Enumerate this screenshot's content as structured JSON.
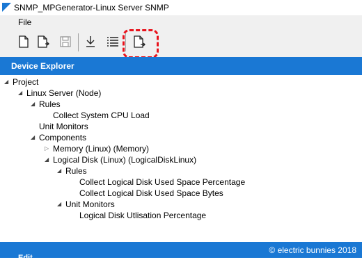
{
  "window": {
    "title": "SNMP_MPGenerator-Linux Server SNMP"
  },
  "menu": {
    "file_label": "File"
  },
  "toolbar": {
    "buttons": [
      "new-document-icon",
      "new-document-arrow-icon",
      "save-icon",
      "download-icon",
      "list-icon",
      "export-document-icon"
    ]
  },
  "explorer": {
    "title": "Device Explorer",
    "tree": {
      "project": "Project",
      "linux_server": "Linux Server (Node)",
      "rules": "Rules",
      "collect_cpu": "Collect System CPU Load",
      "unit_monitors": "Unit Monitors",
      "components": "Components",
      "memory": "Memory (Linux) (Memory)",
      "logical_disk": "Logical Disk (Linux) (LogicalDiskLinux)",
      "ld_rules": "Rules",
      "ld_rule_1": "Collect Logical Disk Used Space Percentage",
      "ld_rule_2": "Collect Logical Disk Used Space Bytes",
      "ld_unit_monitors": "Unit Monitors",
      "ld_monitor_1": "Logical Disk Utlisation Percentage"
    }
  },
  "footer": {
    "partial_label": "Edit",
    "watermark": "© electric bunnies 2018"
  },
  "colors": {
    "accent": "#1a78d4",
    "highlight": "#e8121b"
  }
}
